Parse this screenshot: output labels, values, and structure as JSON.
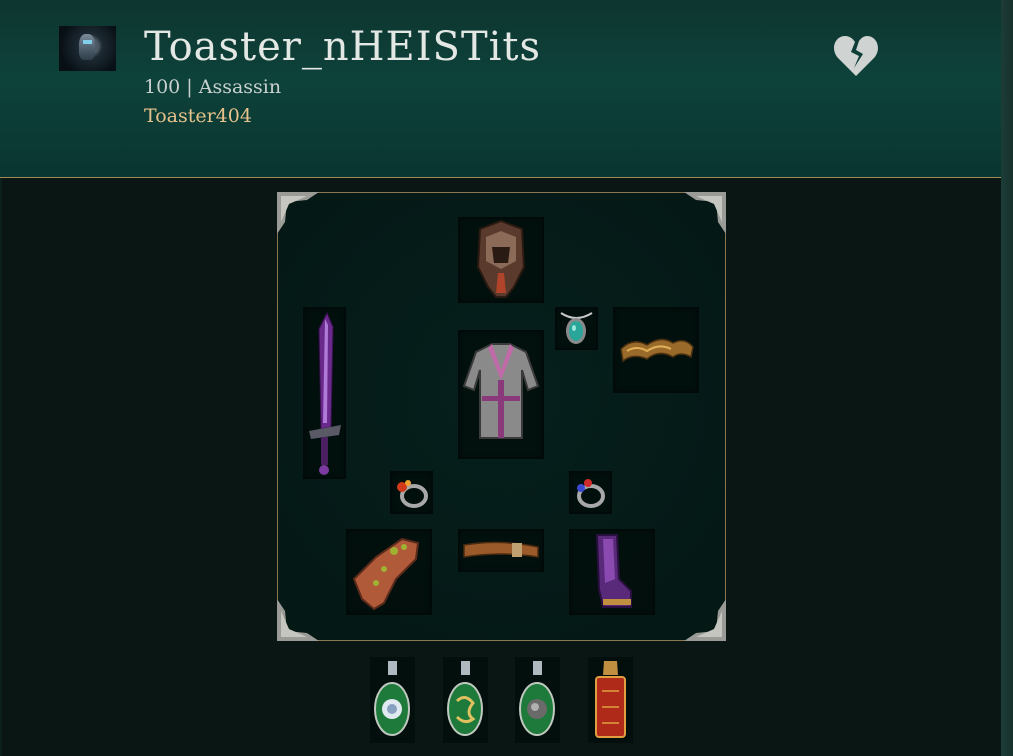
{
  "character": {
    "name": "Toaster_nHEISTits",
    "level_class": "100 | Assassin",
    "account": "Toaster404",
    "avatar_icon": "character-portrait",
    "favorite_icon": "broken-heart-icon"
  },
  "equipment": [
    {
      "slot": "helmet",
      "icon": "helmet-icon"
    },
    {
      "slot": "amulet",
      "icon": "amulet-icon"
    },
    {
      "slot": "weapon",
      "icon": "sword-icon"
    },
    {
      "slot": "body-armour",
      "icon": "body-armour-icon"
    },
    {
      "slot": "offhand",
      "icon": "claw-icon"
    },
    {
      "slot": "ring-left",
      "icon": "ring-icon"
    },
    {
      "slot": "ring-right",
      "icon": "ring-icon"
    },
    {
      "slot": "gloves",
      "icon": "gloves-icon"
    },
    {
      "slot": "belt",
      "icon": "belt-icon"
    },
    {
      "slot": "boots",
      "icon": "boots-icon"
    }
  ],
  "flasks": [
    {
      "slot": "flask-1",
      "icon": "green-flask-icon"
    },
    {
      "slot": "flask-2",
      "icon": "green-flask-icon"
    },
    {
      "slot": "flask-3",
      "icon": "green-flask-icon"
    },
    {
      "slot": "flask-4",
      "icon": "red-flask-icon"
    }
  ],
  "colors": {
    "header_bg": "#0d423a",
    "name_text": "#e4e8e4",
    "account_text": "#e8c28a",
    "panel_border": "#8b7650"
  }
}
